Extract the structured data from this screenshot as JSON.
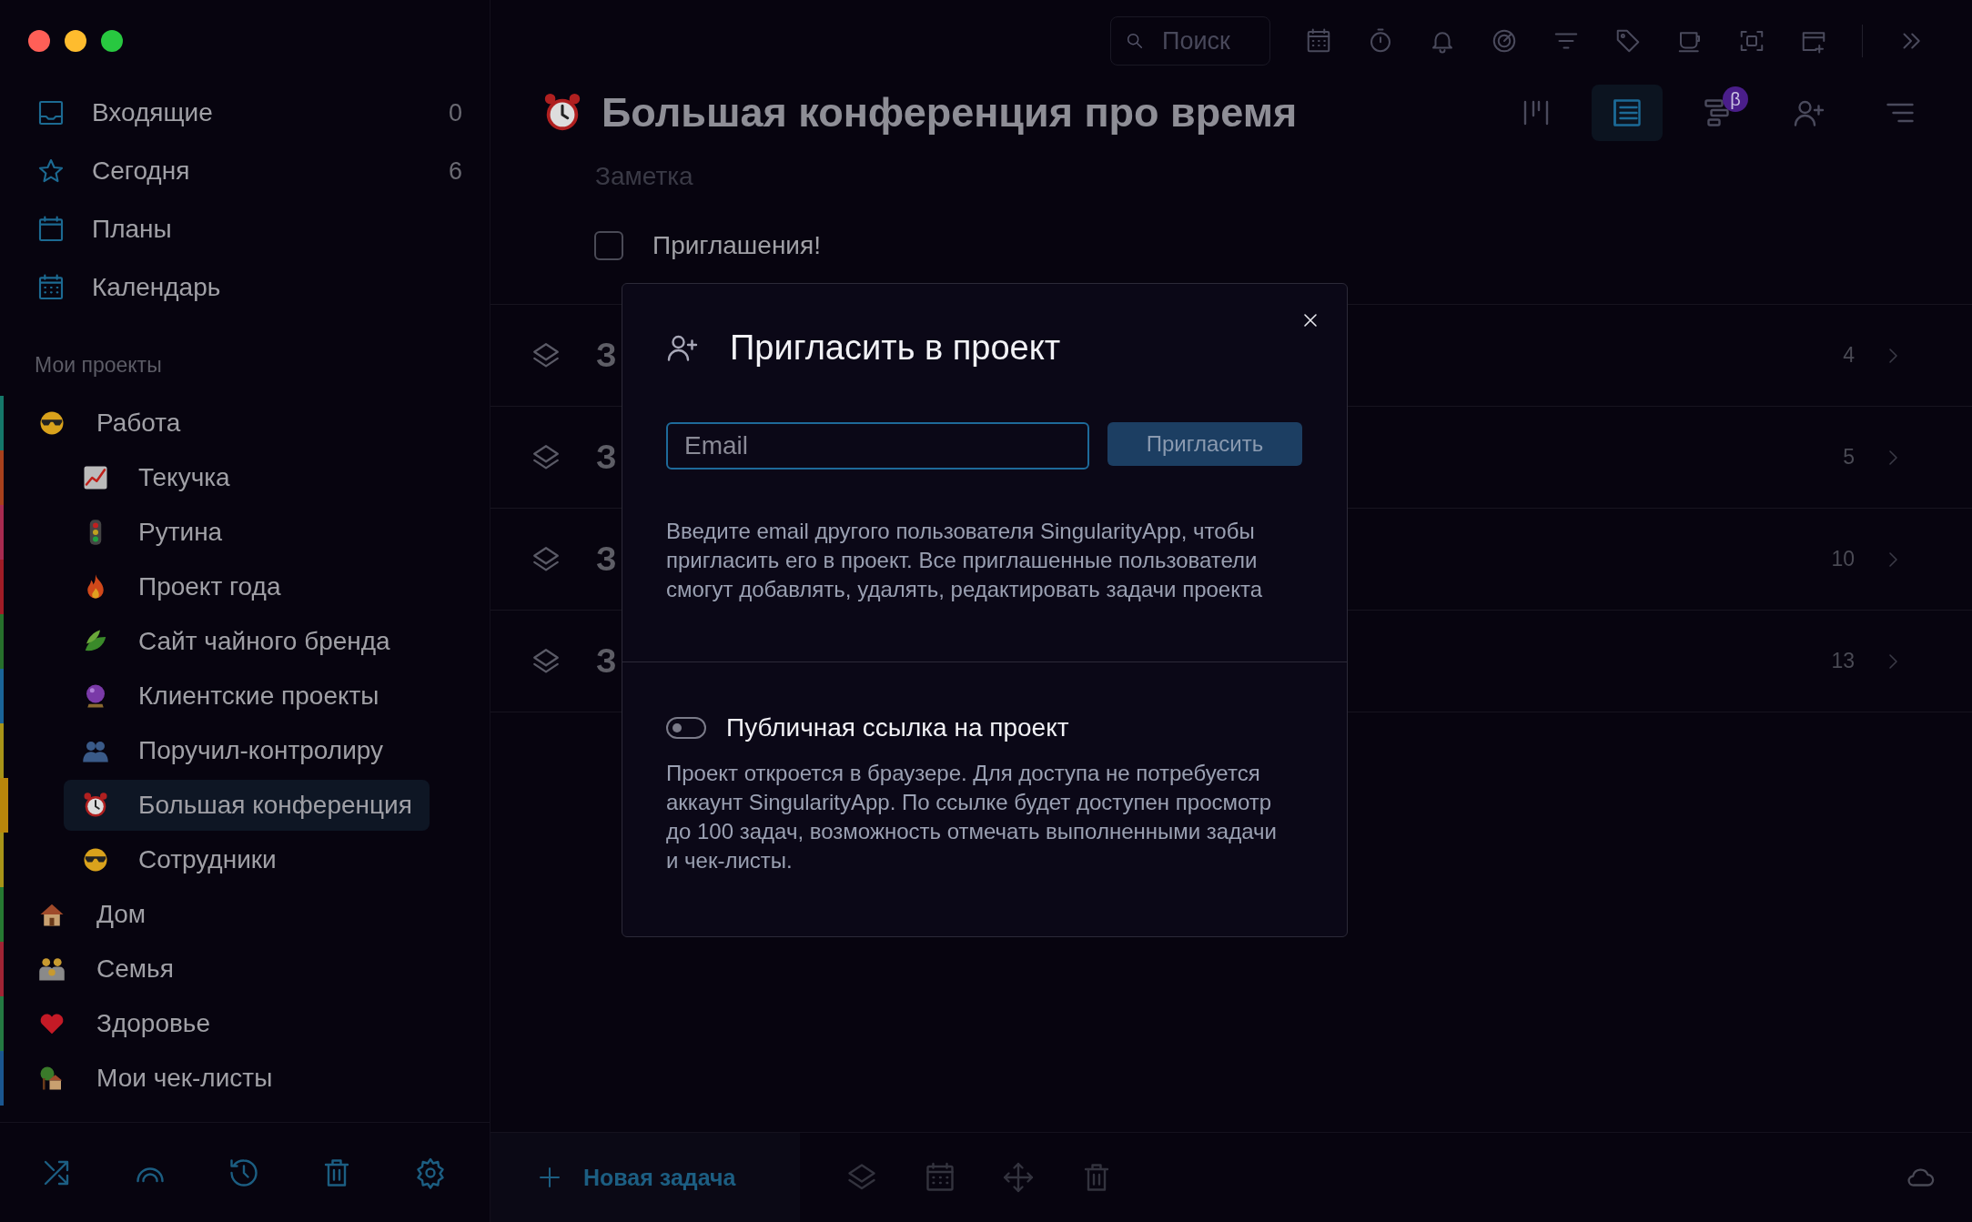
{
  "window": {
    "controls": [
      {
        "color": "#ff5f57"
      },
      {
        "color": "#febc2e"
      },
      {
        "color": "#28c840"
      }
    ]
  },
  "sidebar": {
    "nav": [
      {
        "label": "Входящие",
        "count": "0"
      },
      {
        "label": "Сегодня",
        "count": "6"
      },
      {
        "label": "Планы"
      },
      {
        "label": "Календарь"
      }
    ],
    "section_title": "Мои проекты",
    "projects": [
      {
        "label": "Работа",
        "color": "#15786a",
        "selected": false,
        "children": [
          {
            "label": "Текучка",
            "color": "#a8401c",
            "selected": false
          },
          {
            "label": "Рутина",
            "color": "#a82a50",
            "selected": false
          },
          {
            "label": "Проект года",
            "color": "#a01c26",
            "selected": false
          },
          {
            "label": "Сайт чайного бренда",
            "color": "#27702c",
            "selected": false
          },
          {
            "label": "Клиентские проекты",
            "color": "#1a6498",
            "selected": false
          },
          {
            "label": "Поручил-контролиру",
            "color": "#a89418",
            "selected": false
          },
          {
            "label": "Большая конференция",
            "color": "#b8860b",
            "selected": true
          },
          {
            "label": "Сотрудники",
            "color": "#a89418",
            "selected": false
          }
        ]
      },
      {
        "label": "Дом",
        "color": "#267a32",
        "selected": false
      },
      {
        "label": "Семья",
        "color": "#a02434",
        "selected": false
      },
      {
        "label": "Здоровье",
        "color": "#247a42",
        "selected": false
      },
      {
        "label": "Мои чек-листы",
        "color": "#1a5690",
        "selected": false
      }
    ]
  },
  "toolbar": {
    "search": {
      "placeholder": "Поиск"
    }
  },
  "project": {
    "title": "Большая конференция про время",
    "note": {
      "placeholder": "Заметка"
    },
    "views": [
      {
        "selected": false
      },
      {
        "selected": true
      },
      {
        "selected": false,
        "badge": "β"
      },
      {
        "selected": false
      },
      {
        "selected": false
      }
    ],
    "checklist": [
      {
        "label": "Приглашения!",
        "checked": false
      }
    ],
    "tasks": [
      {
        "title": "З",
        "count": "4"
      },
      {
        "title": "З",
        "count": "5"
      },
      {
        "title": "З",
        "count": "10"
      },
      {
        "title": "З",
        "count": "13"
      }
    ]
  },
  "bottom_bar": {
    "new_task": "Новая задача"
  },
  "dialog": {
    "title": "Пригласить в проект",
    "email": {
      "placeholder": "Email"
    },
    "invite_button": "Пригласить",
    "description": "Введите email другого пользователя SingularityApp, чтобы пригласить его в проект. Все приглашенные пользователи смогут добавлять, удалять, редактировать задачи проекта",
    "public_link": {
      "label": "Публичная ссылка на проект",
      "on": false,
      "description": "Проект откроется в браузере. Для доступа не потребуется аккаунт SingularityApp. По ссылке будет доступен просмотр до 100 задач, возможность отмечать выполненными задачи и чек-листы."
    }
  }
}
